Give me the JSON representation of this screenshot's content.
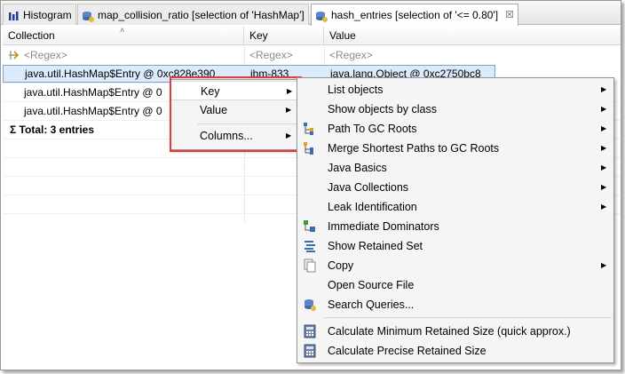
{
  "tabs": [
    {
      "label": "Histogram",
      "icon": "histogram-icon"
    },
    {
      "label": "map_collision_ratio [selection of 'HashMap']",
      "icon": "query-db-icon"
    },
    {
      "label": "hash_entries [selection of '<= 0.80']",
      "icon": "query-db-icon",
      "active": true
    }
  ],
  "tab_close": "☒",
  "table": {
    "columns": [
      "Collection",
      "Key",
      "Value"
    ],
    "regex_placeholder": "<Regex>",
    "rows": [
      {
        "collection": "java.util.HashMap$Entry @ 0xc828e390",
        "key": "ibm-833",
        "value": "java.lang.Object @ 0xc2750bc8"
      },
      {
        "collection": "java.util.HashMap$Entry @ 0",
        "key": "",
        "value": ""
      },
      {
        "collection": "java.util.HashMap$Entry @ 0",
        "key": "",
        "value": ""
      }
    ],
    "total_label": "Total: 3 entries",
    "sigma": "Σ"
  },
  "submenu": {
    "items": [
      "Key",
      "Value",
      "Columns..."
    ]
  },
  "context_menu": {
    "items": [
      {
        "label": "List objects",
        "submenu": true,
        "icon": ""
      },
      {
        "label": "Show objects by class",
        "submenu": true,
        "icon": ""
      },
      {
        "label": "Path To GC Roots",
        "submenu": true,
        "icon": "tree-path-icon"
      },
      {
        "label": "Merge Shortest Paths to GC Roots",
        "submenu": true,
        "icon": "merge-paths-icon"
      },
      {
        "label": "Java Basics",
        "submenu": true,
        "icon": ""
      },
      {
        "label": "Java Collections",
        "submenu": true,
        "icon": ""
      },
      {
        "label": "Leak Identification",
        "submenu": true,
        "icon": ""
      },
      {
        "label": "Immediate Dominators",
        "submenu": false,
        "icon": "dominators-icon"
      },
      {
        "label": "Show Retained Set",
        "submenu": false,
        "icon": "retained-set-icon"
      },
      {
        "label": "Copy",
        "submenu": true,
        "icon": "copy-icon"
      },
      {
        "label": "Open Source File",
        "submenu": false,
        "icon": ""
      },
      {
        "label": "Search Queries...",
        "submenu": false,
        "icon": "search-queries-icon"
      },
      {
        "label": "Calculate Minimum Retained Size (quick approx.)",
        "submenu": false,
        "icon": "calculator-icon"
      },
      {
        "label": "Calculate Precise Retained Size",
        "submenu": false,
        "icon": "calculator-icon"
      }
    ]
  },
  "colors": {
    "highlight_border": "#e23a3a",
    "selection": "#dcebfc"
  }
}
